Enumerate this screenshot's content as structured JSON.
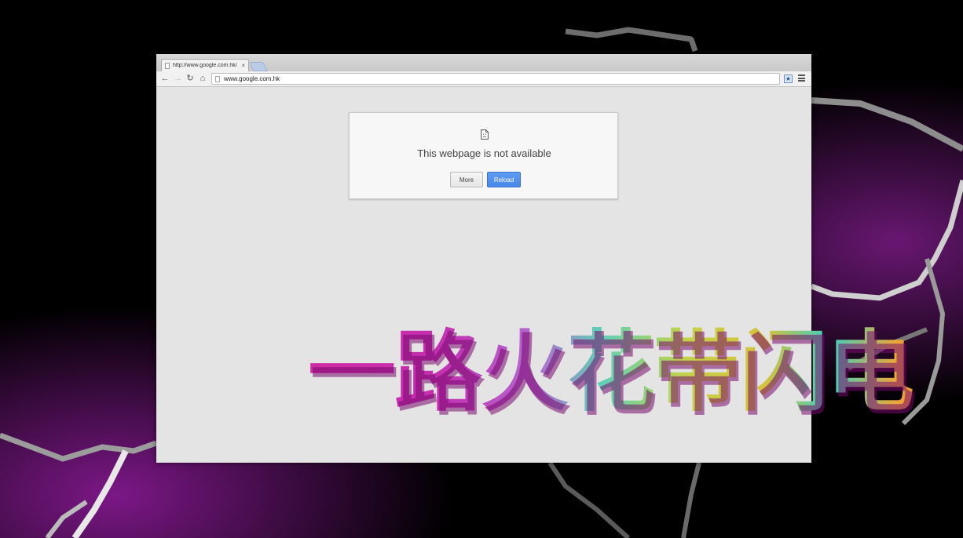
{
  "browser": {
    "tab": {
      "title": "http://www.google.com.hk/",
      "close_glyph": "×"
    },
    "toolbar": {
      "back_icon": "back-arrow-icon",
      "forward_icon": "forward-arrow-icon",
      "reload_icon": "reload-icon",
      "home_icon": "home-icon",
      "back_glyph": "←",
      "forward_glyph": "→",
      "reload_glyph": "↻",
      "home_glyph": "⌂",
      "star_glyph": "★"
    },
    "omnibox": {
      "url": "www.google.com.hk"
    }
  },
  "error_page": {
    "title": "This webpage is not available",
    "more_button": "More",
    "reload_button": "Reload",
    "icon": "sad-page-icon"
  },
  "overlay": {
    "text": "一路火花带闪电"
  },
  "colors": {
    "page_background": "#e4e4e4",
    "reload_button": "#4787ea",
    "desktop_background": "#000000",
    "lightning_glow": "#7b1b86"
  }
}
